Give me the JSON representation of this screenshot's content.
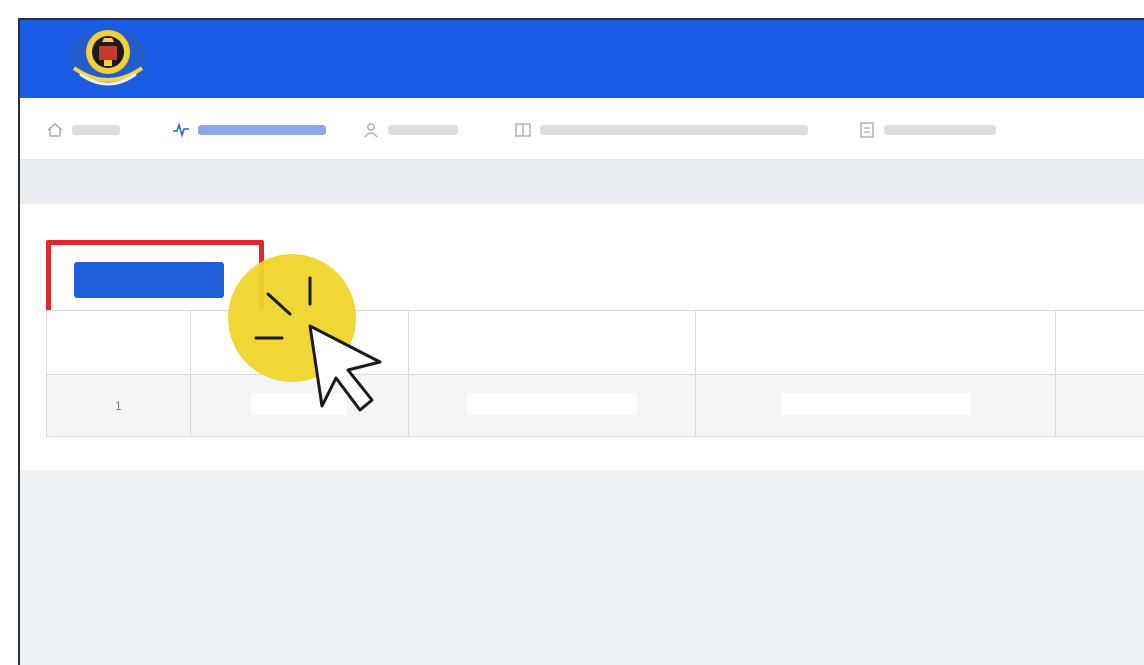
{
  "header": {
    "title": "",
    "brand_color": "#1b5ce6"
  },
  "nav": {
    "items": [
      {
        "label": "",
        "icon": "home-icon",
        "active": false
      },
      {
        "label": "",
        "icon": "activity-icon",
        "active": true
      },
      {
        "label": "",
        "icon": "user-icon",
        "active": false
      },
      {
        "label": "",
        "icon": "book-icon",
        "active": false
      },
      {
        "label": "",
        "icon": "document-icon",
        "active": false
      }
    ]
  },
  "content": {
    "section_title": "",
    "primary_button_label": "",
    "accent_color": "#1f5fd9",
    "highlight_color": "#e0262f"
  },
  "table": {
    "headers": [
      "",
      "",
      "",
      "",
      ""
    ],
    "rows": [
      [
        "1",
        "",
        "",
        "",
        ""
      ]
    ]
  },
  "overlay": {
    "spotlight_color": "#efd52a",
    "cursor_icon": "arrow-cursor-icon"
  }
}
